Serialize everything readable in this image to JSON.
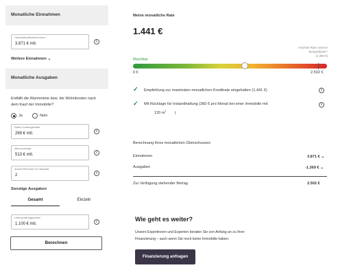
{
  "left": {
    "einnahmen_title": "Monatliche Einnahmen",
    "nettoeinkommen_label": "Haushaltsnettoeinkommen",
    "nettoeinkommen_value": "3.871 € mtl.",
    "weitere_einnahmen": "Weitere Einnahmen",
    "ausgaben_title": "Monatliche Ausgaben",
    "question": "Entfällt die Warmmiete bzw. die Wohnkosten nach dem Kauf der Immobilie?",
    "radio_yes": "Ja",
    "radio_no": "Nein",
    "raten_label": "Raten-/Leasingkredite",
    "raten_value": "269 € mtl.",
    "alter_label": "Altersvorsorge",
    "alter_value": "513 € mtl.",
    "personen_label": "Anzahl Personen im Haushalt",
    "personen_value": "2",
    "sonstige_title": "Sonstige Ausgaben",
    "tab_gesamt": "Gesamt",
    "tab_einzeln": "Einzeln",
    "lebenshaltung_label": "Lebenshaltungskosten",
    "lebenshaltung_value": "1.100 € mtl.",
    "calc_button": "Berechnen"
  },
  "right": {
    "rate_label": "Meine monatliche Rate",
    "rate_value": "1.441 €",
    "machbar": "Machbar",
    "max_note_1": "Höchste Rate unserer",
    "max_note_2": "Beispielbank¹⁾",
    "max_note_3": "(2.386 €)",
    "scale_min": "0 €",
    "scale_max": "2.502 €",
    "rate_fraction": 0.576,
    "max_fraction": 0.954,
    "check1": "Empfehlung zur maximalen monatlichen Kreditrate eingehalten (1.441 €)",
    "check2": "Mit Rücklage für Instandhaltung (360 € pro Monat bei einer Immobilie mit",
    "check2_area": "120 m",
    "check2_sup": "2",
    "check2_end": ")",
    "calc_title": "Berechnung Ihres monatlichen Überschusses",
    "einnahmen_label": "Einnahmen",
    "einnahmen_value": "3.871 €",
    "ausgaben_label": "Ausgaben",
    "ausgaben_value": "-1.369 €",
    "verfuegung_label": "Zur Verfügung stehender Betrag",
    "verfuegung_value": "2.502 €",
    "next_title": "Wie geht es weiter?",
    "next_text_1": "Unsere Expertinnen und Experten beraten Sie von Anfang an zu Ihrer",
    "next_text_2": "Finanzierung – auch wenn Sie noch keine Immobilie haben.",
    "cta_button": "Finanzierung anfragen"
  },
  "colors": {
    "check_green": "#2f7d3c",
    "cta_bg": "#3b3547",
    "machbar_green": "#2f9a3c"
  }
}
